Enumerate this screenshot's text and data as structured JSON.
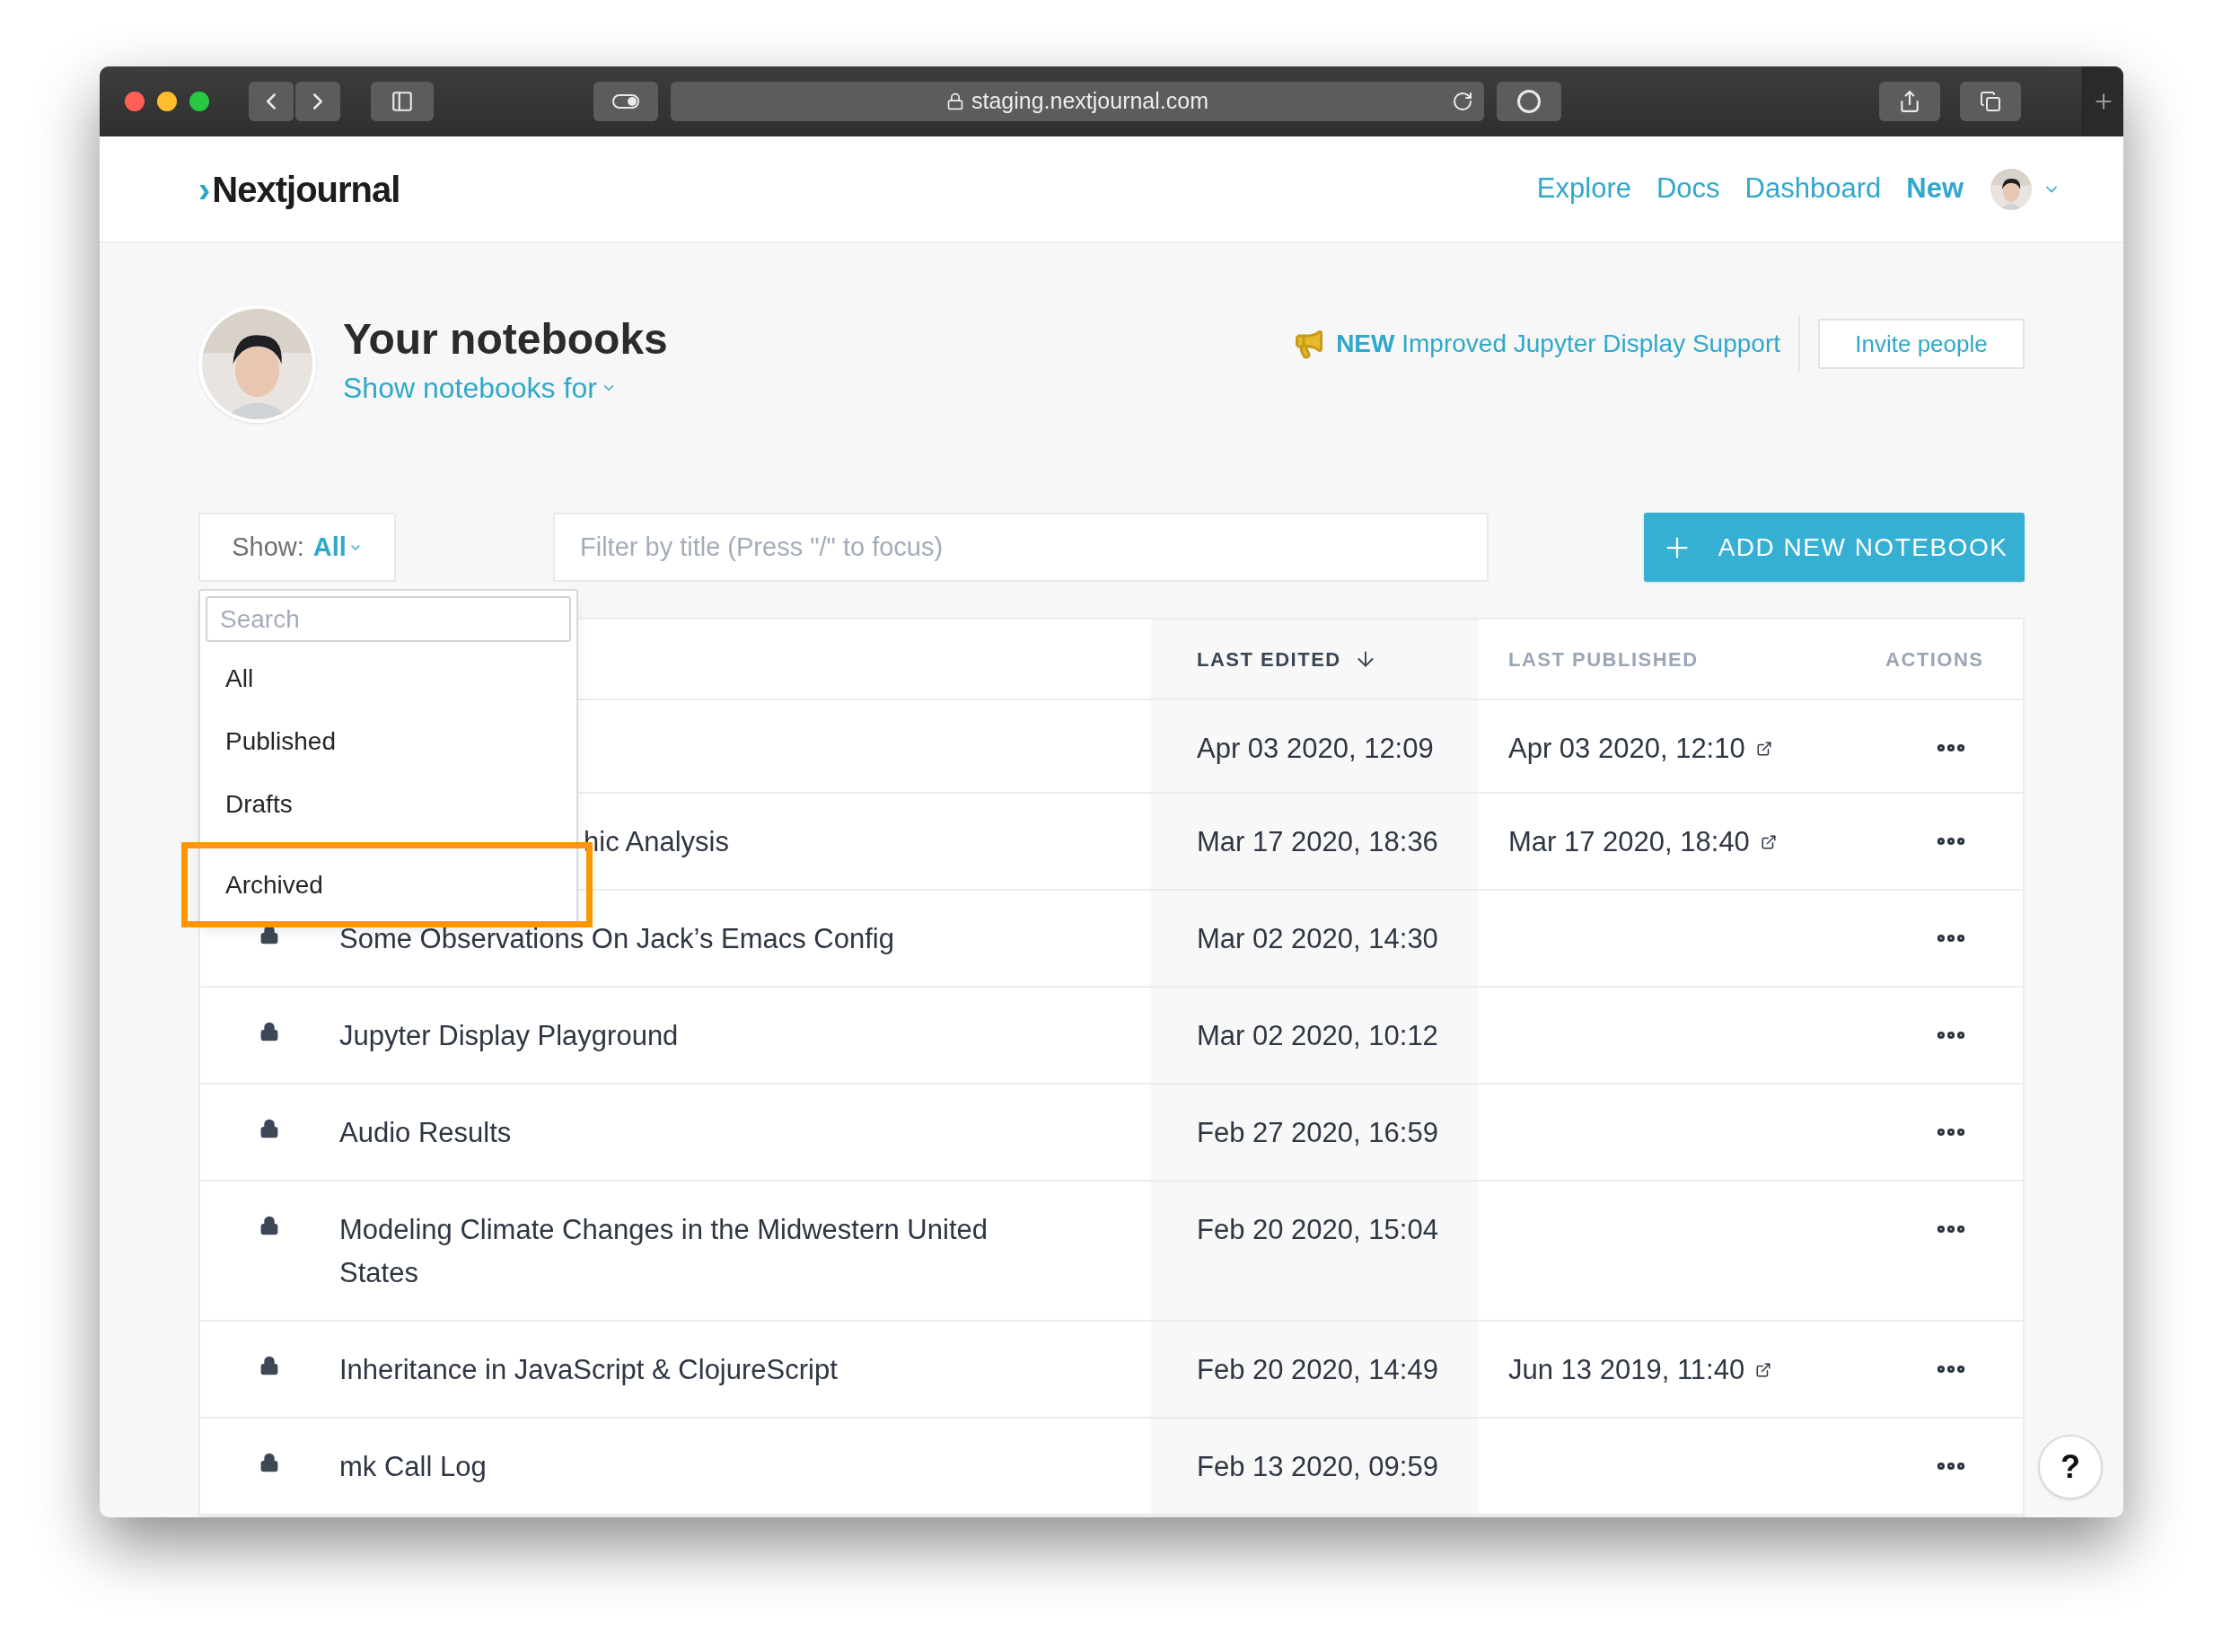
{
  "browser": {
    "url": "staging.nextjournal.com"
  },
  "nav": {
    "logo_mark": "›",
    "logo": "Nextjournal",
    "links": [
      {
        "label": "Explore",
        "bold": false
      },
      {
        "label": "Docs",
        "bold": false
      },
      {
        "label": "Dashboard",
        "bold": false
      },
      {
        "label": "New",
        "bold": true
      }
    ]
  },
  "header": {
    "title": "Your notebooks",
    "subtitle": "Show notebooks for",
    "announcement": {
      "badge": "NEW",
      "text": "Improved Jupyter Display Support"
    },
    "invite_button": "Invite people"
  },
  "filter": {
    "show_label": "Show:",
    "show_value": "All",
    "placeholder": "Filter by title (Press \"/\" to focus)"
  },
  "add_button": "ADD NEW NOTEBOOK",
  "dropdown": {
    "search_placeholder": "Search",
    "items": [
      {
        "label": "All",
        "highlighted": false
      },
      {
        "label": "Published",
        "highlighted": false
      },
      {
        "label": "Drafts",
        "highlighted": false
      },
      {
        "label": "Archived",
        "highlighted": true
      }
    ]
  },
  "table": {
    "columns": [
      {
        "label": "LAST EDITED",
        "sorted": true
      },
      {
        "label": "LAST PUBLISHED",
        "sorted": false
      },
      {
        "label": "ACTIONS",
        "sorted": false
      }
    ],
    "rows": [
      {
        "kind": "covered",
        "last_edited": "Apr 03 2020, 12:09",
        "last_published": "Apr 03 2020, 12:10"
      },
      {
        "kind": "covered",
        "title": "hic Analysis",
        "last_edited": "Mar 17 2020, 18:36",
        "last_published": "Mar 17 2020, 18:40"
      },
      {
        "kind": "full",
        "locked": true,
        "title": "Some Observations On Jack’s Emacs Config",
        "last_edited": "Mar 02 2020, 14:30"
      },
      {
        "kind": "full",
        "locked": true,
        "title": "Jupyter Display Playground",
        "last_edited": "Mar 02 2020, 10:12"
      },
      {
        "kind": "full",
        "locked": true,
        "title": "Audio Results",
        "last_edited": "Feb 27 2020, 16:59"
      },
      {
        "kind": "full",
        "locked": true,
        "title": "Modeling Climate Changes in the Midwestern United States",
        "last_edited": "Feb 20 2020, 15:04"
      },
      {
        "kind": "full",
        "locked": true,
        "title": "Inheritance in JavaScript & ClojureScript",
        "last_edited": "Feb 20 2020, 14:49",
        "last_published": "Jun 13 2019, 11:40"
      },
      {
        "kind": "full",
        "locked": true,
        "title": "mk Call Log",
        "last_edited": "Feb 13 2020, 09:59"
      }
    ]
  },
  "help_button": "?"
}
